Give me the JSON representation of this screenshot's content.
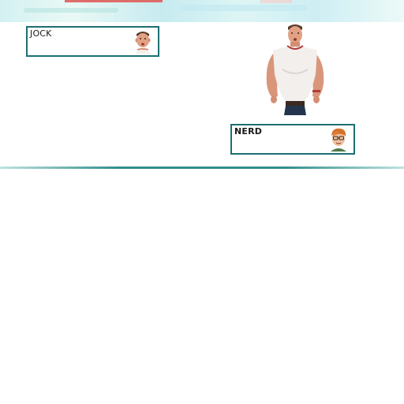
{
  "battle": {
    "enemy": {
      "name": "JOCK",
      "portrait_icon": "jock-face-icon"
    },
    "player": {
      "name": "NERD",
      "portrait_icon": "nerd-face-icon"
    },
    "sprite_icon": "jock-full-body-icon"
  },
  "colors": {
    "box_border": "#1d6f73",
    "divider": "#2f8e8a",
    "sky": "#cdeff0"
  }
}
